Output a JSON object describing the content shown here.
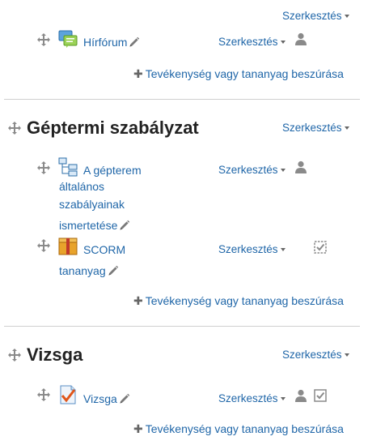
{
  "edit_label": "Szerkesztés",
  "add_activity_label": "Tevékenység vagy tananyag beszúrása",
  "section0": {
    "activities": [
      {
        "title": "Hírfórum",
        "icon": "forum-icon"
      }
    ]
  },
  "section1": {
    "title": "Géptermi szabályzat",
    "activities": [
      {
        "title_lines": [
          "A gépterem",
          "általános",
          "szabályainak",
          "ismertetése"
        ],
        "icon": "folder-tree-icon"
      },
      {
        "title_lines": [
          "SCORM",
          "tananyag"
        ],
        "icon": "scorm-package-icon"
      }
    ]
  },
  "section2": {
    "title": "Vizsga",
    "activities": [
      {
        "title": "Vizsga",
        "icon": "quiz-icon"
      }
    ]
  },
  "colors": {
    "link": "#1f66a8",
    "heading": "#222222",
    "icon_grey": "#8a8a8a",
    "divider": "#cfcfcf"
  }
}
